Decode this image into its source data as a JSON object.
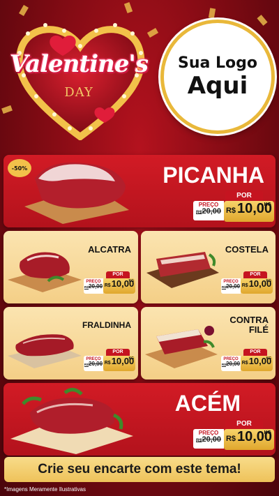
{
  "header": {
    "title": "Valentine's",
    "subtitle": "DAY",
    "logo_line1": "Sua Logo",
    "logo_line2": "Aqui"
  },
  "labels": {
    "preco": "PREÇO",
    "por": "POR",
    "currency": "R$",
    "unit": "KG"
  },
  "products": [
    {
      "name": "PICANHA",
      "discount": "-50%",
      "old_price": "20,00",
      "new_price": "10,00"
    },
    {
      "name": "ALCATRA",
      "old_price": "20,00",
      "new_price": "10,00"
    },
    {
      "name": "COSTELA",
      "old_price": "20,00",
      "new_price": "10,00"
    },
    {
      "name": "FRALDINHA",
      "old_price": "20,00",
      "new_price": "10,00"
    },
    {
      "name": "CONTRA FILÉ",
      "old_price": "20,00",
      "new_price": "10,00"
    },
    {
      "name": "ACÉM",
      "old_price": "20,00",
      "new_price": "10,00"
    }
  ],
  "footer": {
    "banner": "Crie seu encarte com este tema!",
    "disclaimer": "*Imagens Meramente Ilustrativas"
  },
  "colors": {
    "red": "#c51420",
    "gold": "#e9b83a",
    "cream": "#fbe4b0",
    "dark_red": "#7a0a12"
  }
}
